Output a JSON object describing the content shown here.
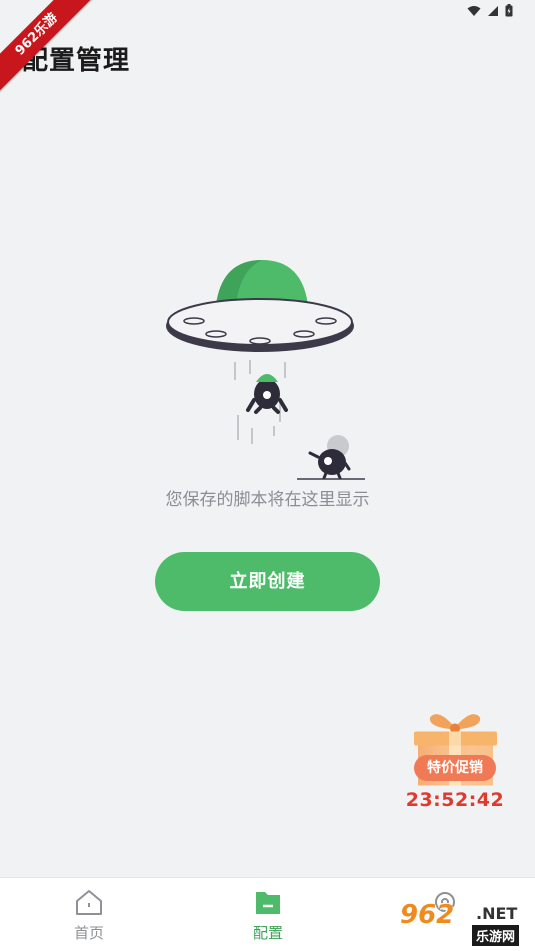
{
  "status_bar": {
    "icons": [
      "wifi-icon",
      "signal-icon",
      "battery-icon"
    ]
  },
  "badge": {
    "text": "962乐游"
  },
  "header": {
    "title": "配置管理"
  },
  "empty_state": {
    "message": "您保存的脚本将在这里显示",
    "create_button_label": "立即创建"
  },
  "promo": {
    "label": "特价促销",
    "timer": "23:52:42"
  },
  "bottom_nav": {
    "items": [
      {
        "label": "首页",
        "icon": "home-icon",
        "active": false
      },
      {
        "label": "配置",
        "icon": "folder-icon",
        "active": true
      },
      {
        "label": "",
        "icon": "settings-icon",
        "active": false
      }
    ]
  },
  "watermark": {
    "main": "962",
    "net": ".NET",
    "sub": "乐游网"
  },
  "colors": {
    "accent": "#4dbb6a",
    "background": "#f1f2f4",
    "timer": "#e03a2e",
    "promo": "#f07a55"
  }
}
